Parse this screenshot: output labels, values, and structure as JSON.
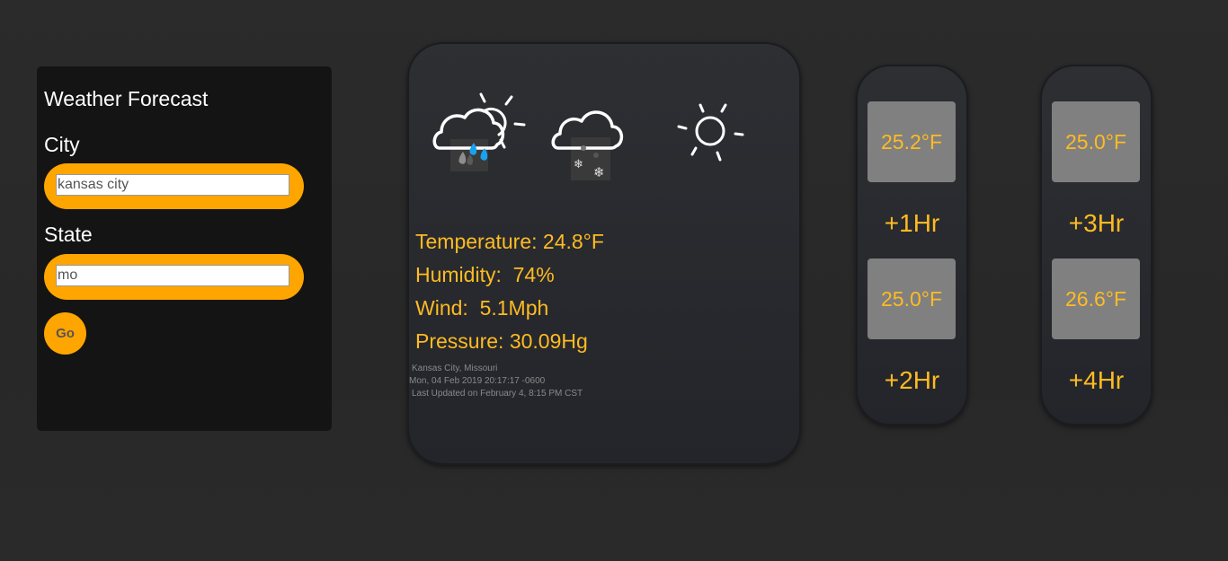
{
  "form": {
    "title": "Weather Forecast",
    "city_label": "City",
    "city_value": "kansas city",
    "state_label": "State",
    "state_value": "mo",
    "go_label": "Go"
  },
  "current": {
    "icons": [
      "rain-sun-icon",
      "snow-cloud-icon",
      "sun-icon"
    ],
    "temperature": "Temperature: 24.8°F",
    "humidity": "Humidity:  74%",
    "wind": "Wind:  5.1Mph",
    "pressure": "Pressure: 30.09Hg",
    "location": "Kansas City, Missouri",
    "timestamp": "Mon, 04 Feb 2019 20:17:17 -0600",
    "last_updated": "Last Updated on February 4, 8:15 PM CST"
  },
  "hourly": [
    {
      "temp": "25.2°F",
      "label": "+1Hr"
    },
    {
      "temp": "25.0°F",
      "label": "+2Hr"
    },
    {
      "temp": "25.0°F",
      "label": "+3Hr"
    },
    {
      "temp": "26.6°F",
      "label": "+4Hr"
    }
  ],
  "colors": {
    "accent": "#ffa500",
    "text_accent": "#ffbb22",
    "temp_box": "#808080",
    "panel": "#141414"
  }
}
